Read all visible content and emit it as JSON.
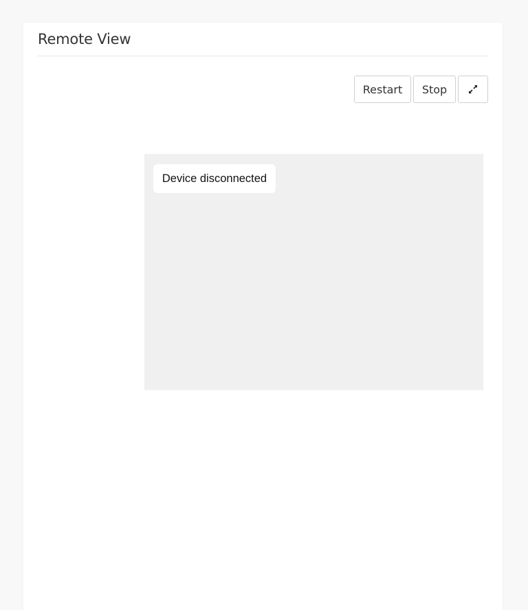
{
  "panel": {
    "title": "Remote View"
  },
  "toolbar": {
    "restart_label": "Restart",
    "stop_label": "Stop",
    "expand_icon": "expand-icon"
  },
  "viewport": {
    "status_text": "Device disconnected",
    "background_color": "#f0f0f0"
  }
}
